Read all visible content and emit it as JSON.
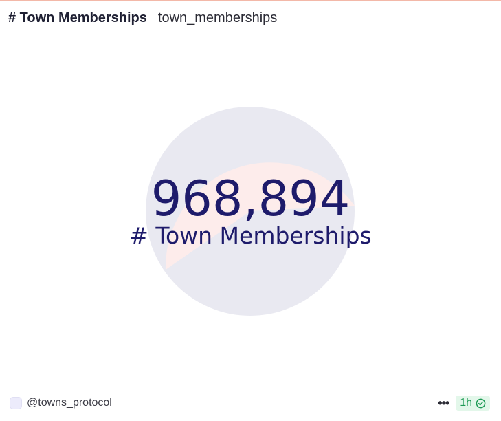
{
  "header": {
    "title": "# Town Memberships",
    "subtitle": "town_memberships"
  },
  "counter": {
    "value": "968,894",
    "label": "# Town Memberships"
  },
  "footer": {
    "creator": "@towns_protocol",
    "refresh_label": "1h",
    "more_icon": "more-horizontal-icon",
    "status_icon": "check-circle-icon"
  },
  "colors": {
    "accent": "#1e1b6b",
    "circle_top": "#fdeceb",
    "circle_bottom": "#e9e9f1",
    "status_green": "#1e9a55"
  }
}
